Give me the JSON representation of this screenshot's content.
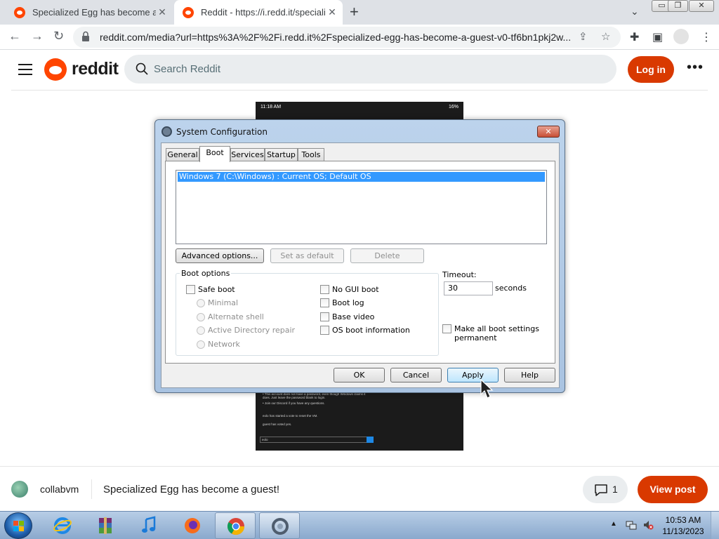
{
  "browser": {
    "tabs": [
      {
        "title": "Specialized Egg has become a gu",
        "active": false
      },
      {
        "title": "Reddit - https://i.redd.it/specializ",
        "active": true
      }
    ],
    "url": "reddit.com/media?url=https%3A%2F%2Fi.redd.it%2Fspecialized-egg-has-become-a-guest-v0-tf6bn1pkj2w...",
    "icons": [
      "back-icon",
      "forward-icon",
      "reload-icon",
      "lock-icon",
      "share-icon",
      "star-icon",
      "extensions-icon",
      "sidepanel-icon",
      "profile-icon",
      "menu-icon"
    ]
  },
  "reddit": {
    "wordmark": "reddit",
    "search_placeholder": "Search Reddit",
    "login_label": "Log in",
    "more_label": "•••",
    "brand_color": "#ff4500",
    "button_color": "#d93900"
  },
  "media": {
    "status_time": "11:18 AM",
    "status_battery": "16%",
    "lower_lines": [
      "• This account does not have a password, even though Windows claims it does. Just leave the password blank to login.",
      "• Join our Discord if you have any questions.",
      "eolo has started a vote to reset the VM.",
      "guest has voted yes."
    ],
    "chat_prefix": "eolo"
  },
  "dialog": {
    "title": "System Configuration",
    "close_label": "✕",
    "tabs": [
      "General",
      "Boot",
      "Services",
      "Startup",
      "Tools"
    ],
    "selected_tab": "Boot",
    "os_entries": [
      "Windows 7 (C:\\Windows) : Current OS; Default OS"
    ],
    "advanced_options_label": "Advanced options...",
    "set_default_label": "Set as default",
    "delete_label": "Delete",
    "boot_options_label": "Boot options",
    "safe_boot_label": "Safe boot",
    "safe_boot_modes": [
      "Minimal",
      "Alternate shell",
      "Active Directory repair",
      "Network"
    ],
    "right_checks": [
      "No GUI boot",
      "Boot log",
      "Base video",
      "OS boot information"
    ],
    "timeout_label": "Timeout:",
    "timeout_value": "30",
    "seconds_label": "seconds",
    "permanent_label_1": "Make all boot settings",
    "permanent_label_2": "permanent",
    "buttons": {
      "ok": "OK",
      "cancel": "Cancel",
      "apply": "Apply",
      "help": "Help"
    }
  },
  "post": {
    "community": "collabvm",
    "title": "Specialized Egg has become a guest!",
    "comment_count": "1",
    "view_post_label": "View post"
  },
  "taskbar": {
    "apps": [
      "internet-explorer",
      "winrar",
      "itunes",
      "firefox",
      "chrome",
      "system-configuration"
    ],
    "time": "10:53 AM",
    "date": "11/13/2023"
  }
}
